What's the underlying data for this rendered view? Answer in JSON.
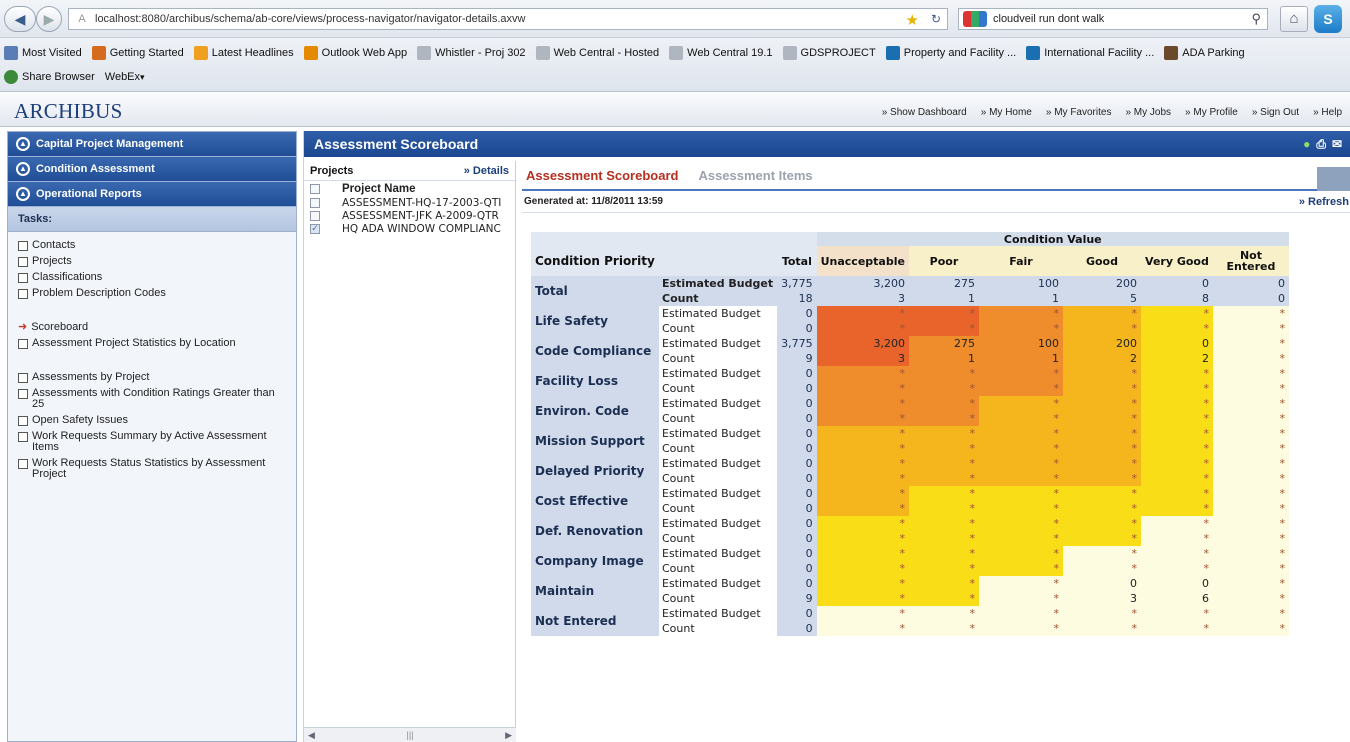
{
  "browser": {
    "url": "localhost:8080/archibus/schema/ab-core/views/process-navigator/navigator-details.axvw",
    "search_value": "cloudveil run dont walk",
    "bookmarks_row1": [
      "Most Visited",
      "Getting Started",
      "Latest Headlines",
      "Outlook Web App",
      "Whistler - Proj 302",
      "Web Central - Hosted",
      "Web Central 19.1",
      "GDSPROJECT",
      "Property and Facility ...",
      "International Facility ...",
      "ADA Parking"
    ],
    "bookmarks_row2": [
      "Share Browser",
      "WebEx"
    ]
  },
  "app": {
    "logo": "ARCHIBUS",
    "links": [
      "» Show Dashboard",
      "» My Home",
      "» My Favorites",
      "» My Jobs",
      "» My Profile",
      "» Sign Out",
      "» Help"
    ]
  },
  "nav": {
    "accordions": [
      "Capital Project Management",
      "Condition Assessment",
      "Operational Reports"
    ],
    "tasks_label": "Tasks:",
    "group1": [
      "Contacts",
      "Projects",
      "Classifications",
      "Problem Description Codes"
    ],
    "group2_current": "Scoreboard",
    "group2": [
      "Assessment Project Statistics by Location"
    ],
    "group3": [
      "Assessments by Project",
      "Assessments with Condition Ratings Greater than 25",
      "Open Safety Issues",
      "Work Requests Summary by Active Assessment Items",
      "Work Requests Status Statistics by Assessment Project"
    ]
  },
  "main": {
    "title": "Assessment Scoreboard",
    "projects_label": "Projects",
    "details_link": "» Details",
    "project_col": "Project Name",
    "projects": [
      {
        "name": "ASSESSMENT-HQ-17-2003-QTI",
        "checked": false
      },
      {
        "name": "ASSESSMENT-JFK A-2009-QTR",
        "checked": false
      },
      {
        "name": "HQ ADA WINDOW COMPLIANC",
        "checked": true
      }
    ],
    "tab_active": "Assessment Scoreboard",
    "tab_inactive": "Assessment Items",
    "generated": "Generated at: 11/8/2011 13:59",
    "refresh": "» Refresh"
  },
  "table": {
    "condition_value_label": "Condition Value",
    "condition_priority_label": "Condition Priority",
    "total_col": "Total",
    "columns": [
      "Unacceptable",
      "Poor",
      "Fair",
      "Good",
      "Very Good",
      "Not Entered"
    ],
    "budget_label": "Estimated Budget",
    "count_label": "Count",
    "total_row": {
      "label": "Total",
      "budget": [
        "3,775",
        "3,200",
        "275",
        "100",
        "200",
        "0",
        "0"
      ],
      "count": [
        "18",
        "3",
        "1",
        "1",
        "5",
        "8",
        "0"
      ]
    },
    "rows": [
      {
        "label": "Life Safety",
        "budget": [
          "0",
          "*",
          "*",
          "*",
          "*",
          "*",
          "*"
        ],
        "count": [
          "0",
          "*",
          "*",
          "*",
          "*",
          "*",
          "*"
        ],
        "colors": [
          "c1",
          "c1",
          "c2",
          "c3",
          "c4",
          "c6"
        ]
      },
      {
        "label": "Code Compliance",
        "budget": [
          "3,775",
          "3,200",
          "275",
          "100",
          "200",
          "0",
          "*"
        ],
        "count": [
          "9",
          "3",
          "1",
          "1",
          "2",
          "2",
          "*"
        ],
        "colors": [
          "c1",
          "c2",
          "c2",
          "c3",
          "c4",
          "c6"
        ]
      },
      {
        "label": "Facility Loss",
        "budget": [
          "0",
          "*",
          "*",
          "*",
          "*",
          "*",
          "*"
        ],
        "count": [
          "0",
          "*",
          "*",
          "*",
          "*",
          "*",
          "*"
        ],
        "colors": [
          "c2",
          "c2",
          "c2",
          "c3",
          "c4",
          "c6"
        ]
      },
      {
        "label": "Environ. Code",
        "budget": [
          "0",
          "*",
          "*",
          "*",
          "*",
          "*",
          "*"
        ],
        "count": [
          "0",
          "*",
          "*",
          "*",
          "*",
          "*",
          "*"
        ],
        "colors": [
          "c2",
          "c2",
          "c3",
          "c3",
          "c4",
          "c6"
        ]
      },
      {
        "label": "Mission Support",
        "budget": [
          "0",
          "*",
          "*",
          "*",
          "*",
          "*",
          "*"
        ],
        "count": [
          "0",
          "*",
          "*",
          "*",
          "*",
          "*",
          "*"
        ],
        "colors": [
          "c3",
          "c3",
          "c3",
          "c3",
          "c4",
          "c6"
        ]
      },
      {
        "label": "Delayed Priority",
        "budget": [
          "0",
          "*",
          "*",
          "*",
          "*",
          "*",
          "*"
        ],
        "count": [
          "0",
          "*",
          "*",
          "*",
          "*",
          "*",
          "*"
        ],
        "colors": [
          "c3",
          "c3",
          "c3",
          "c3",
          "c4",
          "c6"
        ]
      },
      {
        "label": "Cost Effective",
        "budget": [
          "0",
          "*",
          "*",
          "*",
          "*",
          "*",
          "*"
        ],
        "count": [
          "0",
          "*",
          "*",
          "*",
          "*",
          "*",
          "*"
        ],
        "colors": [
          "c3",
          "c4",
          "c4",
          "c4",
          "c4",
          "c6"
        ]
      },
      {
        "label": "Def. Renovation",
        "budget": [
          "0",
          "*",
          "*",
          "*",
          "*",
          "*",
          "*"
        ],
        "count": [
          "0",
          "*",
          "*",
          "*",
          "*",
          "*",
          "*"
        ],
        "colors": [
          "c4",
          "c4",
          "c4",
          "c4",
          "c6",
          "c6"
        ]
      },
      {
        "label": "Company Image",
        "budget": [
          "0",
          "*",
          "*",
          "*",
          "*",
          "*",
          "*"
        ],
        "count": [
          "0",
          "*",
          "*",
          "*",
          "*",
          "*",
          "*"
        ],
        "colors": [
          "c4",
          "c4",
          "c4",
          "c6",
          "c6",
          "c6"
        ]
      },
      {
        "label": "Maintain",
        "budget": [
          "0",
          "*",
          "*",
          "*",
          "0",
          "0",
          "*"
        ],
        "count": [
          "9",
          "*",
          "*",
          "*",
          "3",
          "6",
          "*"
        ],
        "colors": [
          "c4",
          "c4",
          "c6",
          "c6",
          "c6",
          "c6"
        ]
      },
      {
        "label": "Not Entered",
        "budget": [
          "0",
          "*",
          "*",
          "*",
          "*",
          "*",
          "*"
        ],
        "count": [
          "0",
          "*",
          "*",
          "*",
          "*",
          "*",
          "*"
        ],
        "colors": [
          "c6",
          "c6",
          "c6",
          "c6",
          "c6",
          "c6"
        ]
      }
    ]
  }
}
